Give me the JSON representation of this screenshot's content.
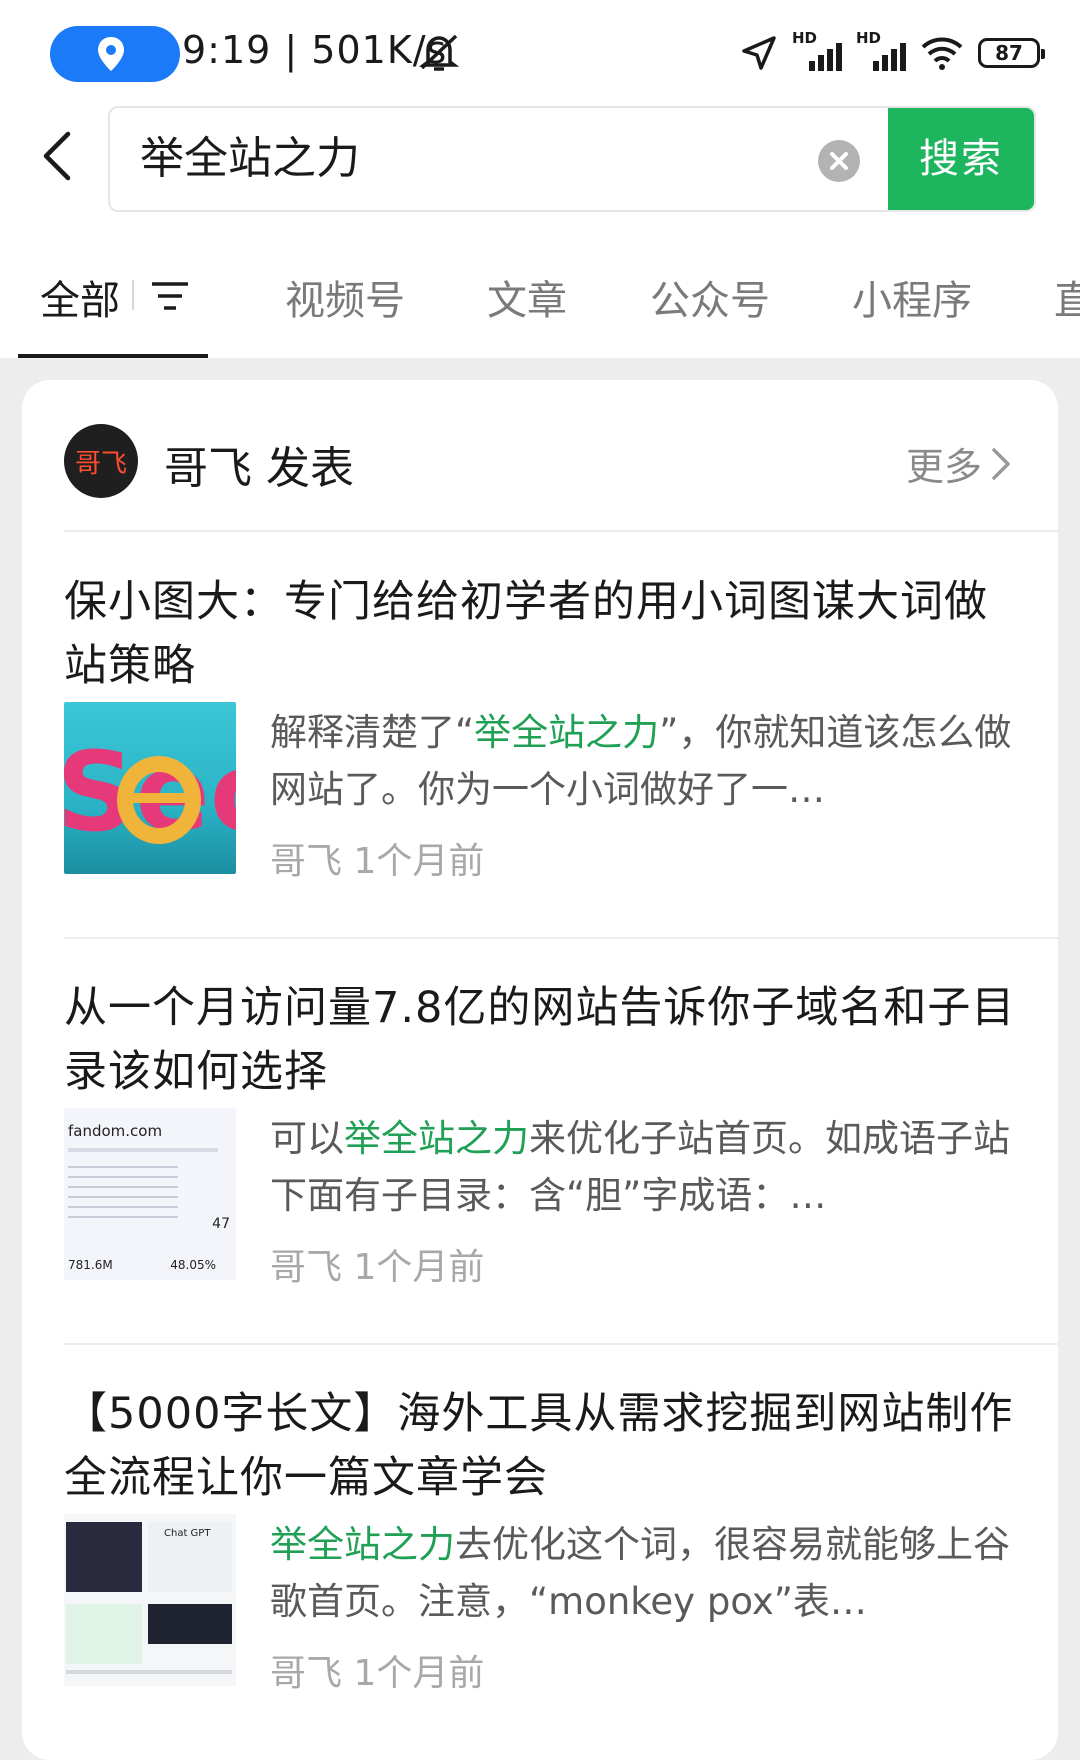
{
  "status": {
    "time_speed": "9:19 | 501K/s",
    "battery": "87"
  },
  "search": {
    "query": "举全站之力",
    "button_label": "搜索"
  },
  "tabs": [
    {
      "label": "全部",
      "active": true
    },
    {
      "label": "视频号"
    },
    {
      "label": "文章"
    },
    {
      "label": "公众号"
    },
    {
      "label": "小程序"
    },
    {
      "label": "直"
    }
  ],
  "account": {
    "avatar_text": "哥飞",
    "header": "哥飞 发表",
    "more_label": "更多"
  },
  "articles": [
    {
      "title": "保小图大：专门给给初学者的用小词图谋大词做站策略",
      "snippet_pre": "解释清楚了“",
      "snippet_hl": "举全站之力",
      "snippet_post": "”，你就知道该怎么做网站了。你为一个小词做好了一…",
      "meta": "哥飞  1个月前",
      "thumb_text": "Seo"
    },
    {
      "title": "从一个月访问量7.8亿的网站告诉你子域名和子目录该如何选择",
      "snippet_pre": "可以",
      "snippet_hl": "举全站之力",
      "snippet_post": "来优化子站首页。如成语子站下面有子目录：含“胆”字成语：…",
      "meta": "哥飞  1个月前",
      "thumb_text": "fandom.com",
      "thumb_stat1": "781.6M",
      "thumb_stat2": "48.05%",
      "thumb_stat3": "47"
    },
    {
      "title": "【5000字长文】海外工具从需求挖掘到网站制作全流程让你一篇文章学会",
      "snippet_pre": "",
      "snippet_hl": "举全站之力",
      "snippet_post": "去优化这个词，很容易就能够上谷歌首页。注意，“monkey pox”表…",
      "meta": "哥飞  1个月前",
      "thumb_text": "Chat GPT"
    }
  ],
  "colors": {
    "accent": "#1db55e",
    "highlight": "#1fa055",
    "location": "#1a7af8"
  }
}
